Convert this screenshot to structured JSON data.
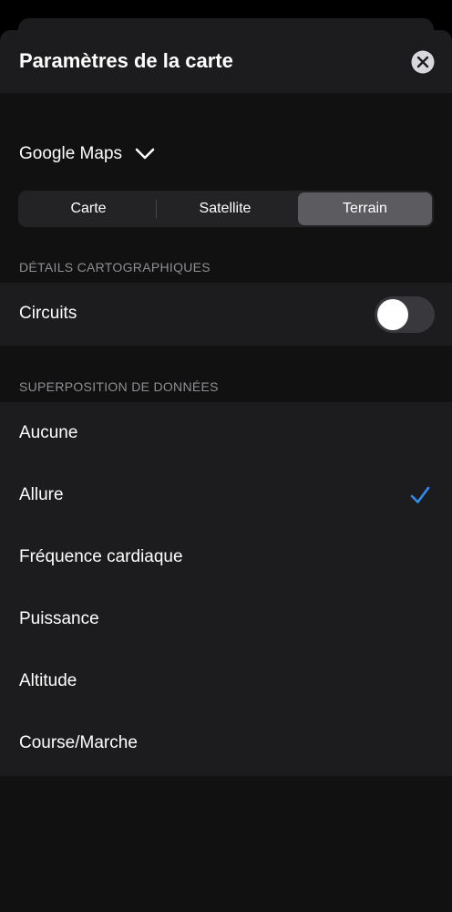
{
  "header": {
    "title": "Paramètres de la carte"
  },
  "icons": {
    "close": "close-circle-icon",
    "chevron": "chevron-down-icon",
    "check": "checkmark-icon"
  },
  "provider": {
    "label": "Google Maps"
  },
  "map_type": {
    "options": [
      "Carte",
      "Satellite",
      "Terrain"
    ],
    "selected": "Terrain"
  },
  "map_details": {
    "header": "DÉTAILS CARTOGRAPHIQUES",
    "circuits": {
      "label": "Circuits",
      "enabled": false
    }
  },
  "data_overlay": {
    "header": "SUPERPOSITION DE DONNÉES",
    "items": [
      "Aucune",
      "Allure",
      "Fréquence cardiaque",
      "Puissance",
      "Altitude",
      "Course/Marche"
    ],
    "selected": "Allure"
  },
  "colors": {
    "accent": "#2f8cf0",
    "background": "#111111",
    "cell": "#1c1c1e",
    "selected_segment": "#5c5c60"
  }
}
